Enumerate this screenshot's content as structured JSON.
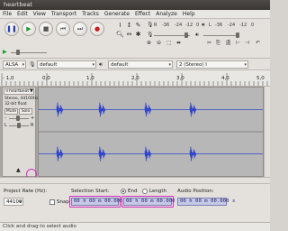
{
  "window": {
    "title": "heartbeat"
  },
  "menu": [
    "File",
    "Edit",
    "View",
    "Transport",
    "Tracks",
    "Generate",
    "Effect",
    "Analyze",
    "Help"
  ],
  "transport": {
    "buttons": [
      {
        "name": "pause-button",
        "glyph": "❚❚",
        "color": "#2a3ea0"
      },
      {
        "name": "play-button",
        "glyph": "▶",
        "color": "#1c9a2a"
      },
      {
        "name": "stop-button",
        "glyph": "■",
        "color": "#555555"
      },
      {
        "name": "skip-start-button",
        "glyph": "⏮",
        "color": "#555555"
      },
      {
        "name": "skip-end-button",
        "glyph": "⏭",
        "color": "#555555"
      },
      {
        "name": "record-button",
        "glyph": "●",
        "color": "#c42020"
      }
    ]
  },
  "meters": {
    "record_label": "R",
    "playback_label": "L",
    "scale": [
      "-36",
      "-24",
      "-12",
      "0"
    ]
  },
  "device": {
    "host": "ALSA",
    "recording_device": "default",
    "playback_device": "default",
    "channels": "2 (Stereo) I"
  },
  "ruler": {
    "labels": [
      "- 1,0",
      "0,0",
      "1,0",
      "2,0",
      "3,0",
      "4,0",
      "5,0"
    ]
  },
  "track": {
    "name": "heartbeat",
    "format": "Stereo, 44100Hz",
    "bit_depth": "32-bit float",
    "mute_label": "Mute",
    "solo_label": "Solo",
    "gain_minus": "-",
    "gain_plus": "+",
    "pan_left": "L",
    "pan_right": "R",
    "scale_labels": [
      "1,0",
      "0,5",
      "0,0",
      "-0,5",
      "-1,0"
    ],
    "wave_color": "#3246c8"
  },
  "selection_toolbar": {
    "project_rate_label": "Project Rate (Hz):",
    "project_rate_value": "44100",
    "snap_to_label": "Snap To",
    "selection_start_label": "Selection Start:",
    "end_label": "End",
    "length_label": "Length",
    "start_time": "00 h 00 m 00.000 s",
    "end_time": "00 h 00 m 00.000 s",
    "audio_position_label": "Audio Position:",
    "audio_position": "00 h 00 m 00.000 s"
  },
  "status": {
    "text": "Click and drag to select audio"
  }
}
